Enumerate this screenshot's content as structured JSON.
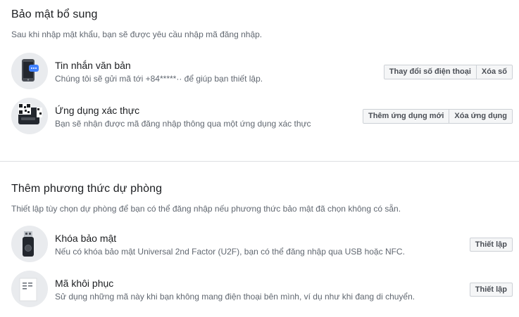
{
  "primary": {
    "title": "Bảo mật bổ sung",
    "description": "Sau khi nhập mật khẩu, bạn sẽ được yêu cầu nhập mã đăng nhập.",
    "items": [
      {
        "icon": "phone-sms-icon",
        "title": "Tin nhắn văn bản",
        "description": "Chúng tôi sẽ gửi mã tới +84*****·· để giúp bạn thiết lập.",
        "buttons": [
          "Thay đổi số điện thoại",
          "Xóa số"
        ]
      },
      {
        "icon": "authenticator-app-icon",
        "title": "Ứng dụng xác thực",
        "description": "Bạn sẽ nhận được mã đăng nhập thông qua một ứng dụng xác thực",
        "buttons": [
          "Thêm ứng dụng mới",
          "Xóa ứng dụng"
        ]
      }
    ]
  },
  "backup": {
    "title": "Thêm phương thức dự phòng",
    "description": "Thiết lập tùy chọn dự phòng để bạn có thể đăng nhập nếu phương thức bảo mật đã chọn không có sẵn.",
    "items": [
      {
        "icon": "security-key-icon",
        "title": "Khóa bảo mật",
        "description": "Nếu có khóa bảo mật Universal 2nd Factor (U2F), bạn có thể đăng nhập qua USB hoặc NFC.",
        "button": "Thiết lập"
      },
      {
        "icon": "recovery-codes-icon",
        "title": "Mã khôi phục",
        "description": "Sử dụng những mã này khi bạn không mang điện thoại bên mình, ví dụ như khi đang di chuyển.",
        "button": "Thiết lập"
      }
    ]
  },
  "colors": {
    "heading": "#1c1e21",
    "muted": "#606770",
    "button_bg": "#f5f6f7",
    "button_border": "#ccd0d5",
    "accent_blue": "#4080ff"
  }
}
